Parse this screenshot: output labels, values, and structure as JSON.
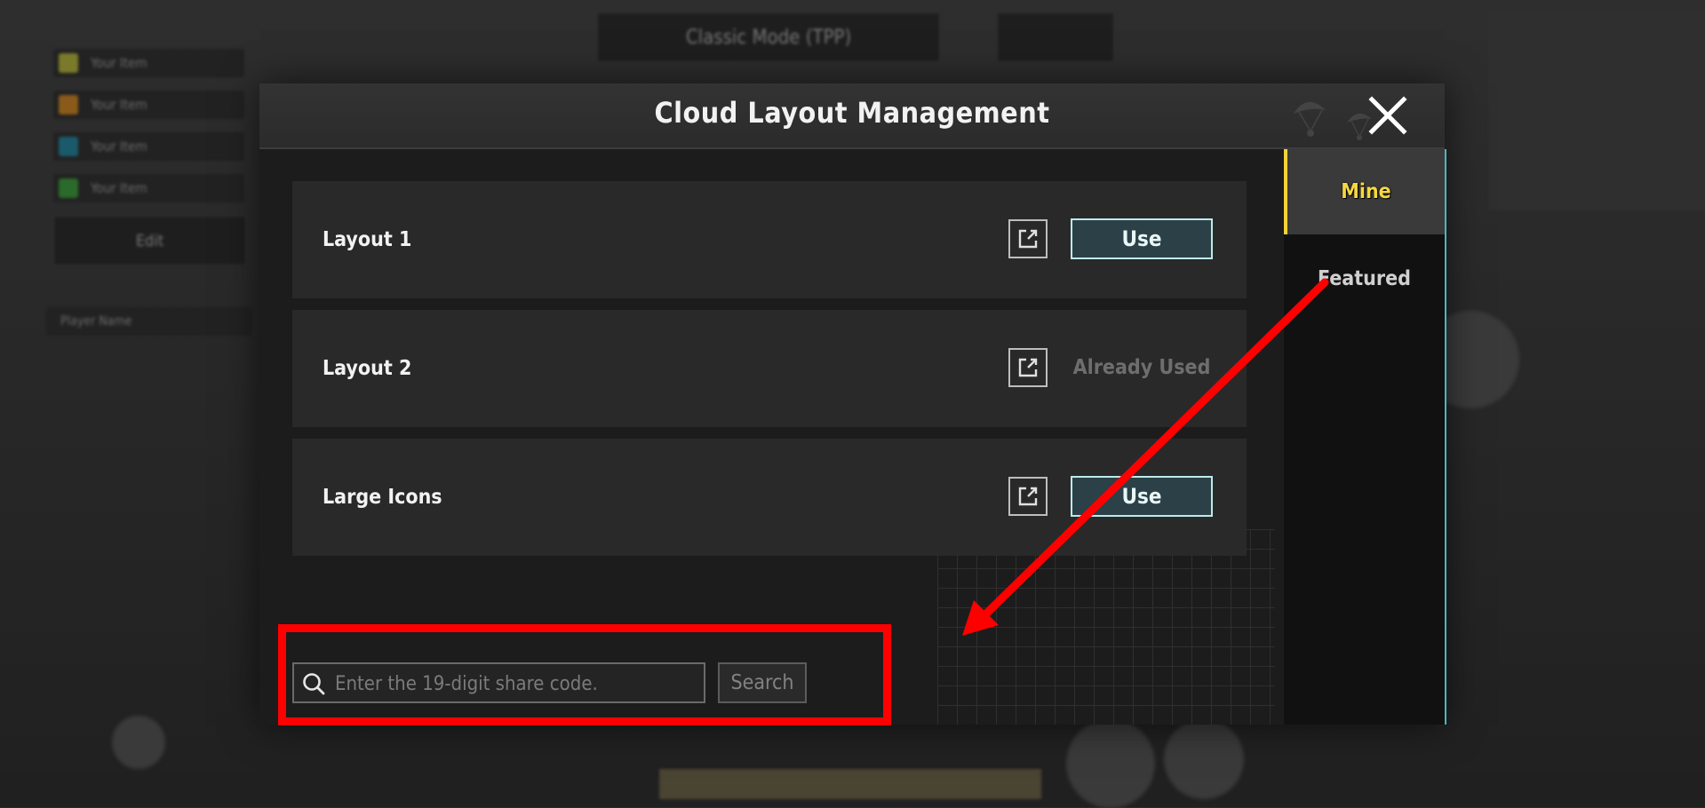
{
  "dialog": {
    "title": "Cloud Layout Management"
  },
  "layouts": [
    {
      "name": "Layout 1",
      "action": "Use",
      "state": "available"
    },
    {
      "name": "Layout 2",
      "action": "Already Used",
      "state": "used"
    },
    {
      "name": "Large Icons",
      "action": "Use",
      "state": "available"
    }
  ],
  "search": {
    "placeholder": "Enter the 19-digit share code.",
    "value": "",
    "button_label": "Search"
  },
  "tabs": [
    {
      "label": "Mine",
      "active": true
    },
    {
      "label": "Featured",
      "active": false
    }
  ],
  "background": {
    "mode_select": "Classic Mode (TPP)",
    "player_label": "Player Name",
    "edit_label": "Edit",
    "left_items": [
      "Your Item",
      "Your Item",
      "Your Item",
      "Your Item"
    ],
    "left_item_colors": [
      "#8a8a2a",
      "#9a5a1a",
      "#1a6a7a",
      "#3a7a2a"
    ]
  },
  "annotation": {
    "color": "#ff0000"
  },
  "icons": {
    "close": "close-icon",
    "share": "share-export-icon",
    "search": "search-icon"
  }
}
